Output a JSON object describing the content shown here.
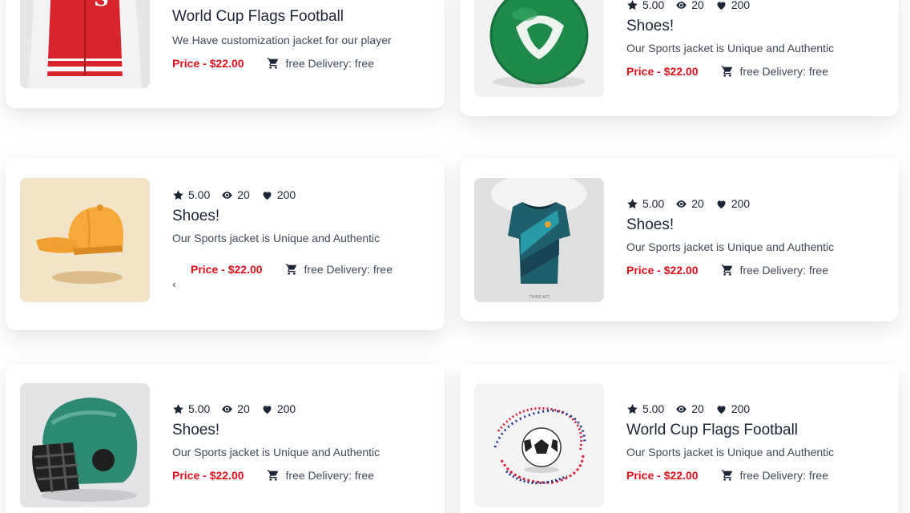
{
  "products": [
    {
      "image": "red-varsity-jacket",
      "title": "World Cup Flags Football",
      "description": "We Have customization jacket for our player",
      "price": "Price - $22.00",
      "delivery": "free Delivery: free"
    },
    {
      "image": "green-soccer-ball",
      "rating": "5.00",
      "views": "20",
      "likes": "200",
      "title": "Shoes!",
      "description": "Our Sports jacket is Unique and Authentic",
      "price": "Price - $22.00",
      "delivery": "free Delivery: free"
    },
    {
      "image": "orange-cap",
      "rating": "5.00",
      "views": "20",
      "likes": "200",
      "title": "Shoes!",
      "description": "Our Sports jacket is Unique and Authentic",
      "price": "Price - $22.00",
      "delivery": "free Delivery: free",
      "prev_arrow": "‹"
    },
    {
      "image": "teal-football-jersey",
      "rating": "5.00",
      "views": "20",
      "likes": "200",
      "title": "Shoes!",
      "description": "Our Sports jacket is Unique and Authentic",
      "price": "Price - $22.00",
      "delivery": "free Delivery: free"
    },
    {
      "image": "green-football-helmet",
      "rating": "5.00",
      "views": "20",
      "likes": "200",
      "title": "Shoes!",
      "description": "Our Sports jacket is Unique and Authentic",
      "price": "Price - $22.00",
      "delivery": "free Delivery: free"
    },
    {
      "image": "soccer-ball-flag-swirl",
      "rating": "5.00",
      "views": "20",
      "likes": "200",
      "title": "World Cup Flags Football",
      "description": "Our Sports jacket is Unique and Authentic",
      "price": "Price - $22.00",
      "delivery": "free Delivery: free"
    }
  ],
  "colors": {
    "price": "#e3101b",
    "text_dark": "#1c2536",
    "text_muted": "#3f4a5a",
    "card_background": "#ffffff"
  }
}
